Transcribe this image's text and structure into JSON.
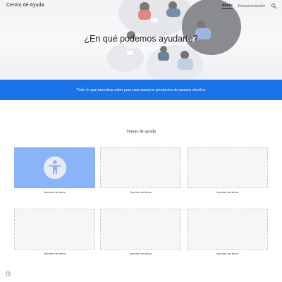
{
  "header": {
    "site_title": "Centro de Ayuda",
    "nav": [
      {
        "label": "Inicio",
        "active": true
      },
      {
        "label": "Documentación",
        "active": false
      }
    ],
    "search_icon": "search-icon"
  },
  "hero": {
    "heading": "¿En qué podemos ayudarte?"
  },
  "banner": {
    "text": "Todo lo que necesitas saber para usar nuestros productos de manera efectiva",
    "color": "#1a73e8"
  },
  "topics": {
    "title": "Temas de ayuda",
    "cards": [
      {
        "label": "Nombre del tema",
        "icon": "accessibility-icon",
        "accent": "#8ab4f8"
      },
      {
        "label": "Nombre del tema"
      },
      {
        "label": "Nombre del tema"
      },
      {
        "label": "Nombre del tema"
      },
      {
        "label": "Nombre del tema"
      },
      {
        "label": "Nombre del tema"
      }
    ]
  },
  "footer": {
    "info_icon": "info-icon"
  }
}
